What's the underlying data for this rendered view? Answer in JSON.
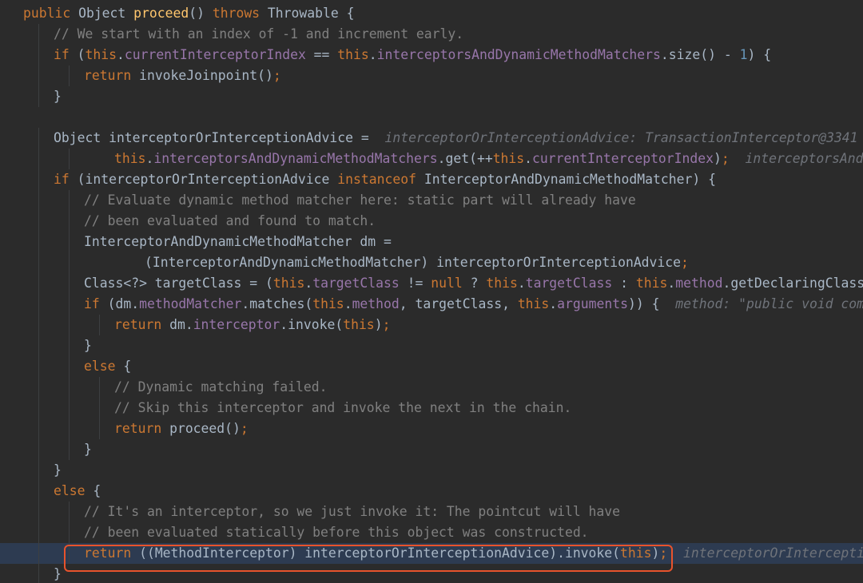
{
  "code_lines": [
    [
      [
        "kw",
        "public "
      ],
      [
        "plain",
        "Object "
      ],
      [
        "fn",
        "proceed"
      ],
      [
        "plain",
        "() "
      ],
      [
        "kw",
        "throws "
      ],
      [
        "plain",
        "Throwable {"
      ]
    ],
    [
      [
        "cmt",
        "// We start with an index of -1 and increment early."
      ]
    ],
    [
      [
        "kw",
        "if "
      ],
      [
        "plain",
        "("
      ],
      [
        "kw",
        "this"
      ],
      [
        "plain",
        "."
      ],
      [
        "fld",
        "currentInterceptorIndex"
      ],
      [
        "plain",
        " == "
      ],
      [
        "kw",
        "this"
      ],
      [
        "plain",
        "."
      ],
      [
        "fld",
        "interceptorsAndDynamicMethodMatchers"
      ],
      [
        "plain",
        ".size() - "
      ],
      [
        "num",
        "1"
      ],
      [
        "plain",
        ") {"
      ]
    ],
    [
      [
        "kw",
        "return "
      ],
      [
        "plain",
        "invokeJoinpoint()"
      ],
      [
        "kw",
        ";"
      ]
    ],
    [
      [
        "plain",
        "}"
      ]
    ],
    [],
    [
      [
        "plain",
        "Object interceptorOrInterceptionAdvice = "
      ],
      [
        "hint",
        " interceptorOrInterceptionAdvice: TransactionInterceptor@3341"
      ]
    ],
    [
      [
        "kw",
        "this"
      ],
      [
        "plain",
        "."
      ],
      [
        "fld",
        "interceptorsAndDynamicMethodMatchers"
      ],
      [
        "plain",
        ".get(++"
      ],
      [
        "kw",
        "this"
      ],
      [
        "plain",
        "."
      ],
      [
        "fld",
        "currentInterceptorIndex"
      ],
      [
        "plain",
        ")"
      ],
      [
        "kw",
        ";"
      ],
      [
        "hint",
        "  interceptorsAndDyna"
      ]
    ],
    [
      [
        "kw",
        "if "
      ],
      [
        "plain",
        "(interceptorOrInterceptionAdvice "
      ],
      [
        "kw",
        "instanceof "
      ],
      [
        "plain",
        "InterceptorAndDynamicMethodMatcher) {"
      ]
    ],
    [
      [
        "cmt",
        "// Evaluate dynamic method matcher here: static part will already have"
      ]
    ],
    [
      [
        "cmt",
        "// been evaluated and found to match."
      ]
    ],
    [
      [
        "plain",
        "InterceptorAndDynamicMethodMatcher dm ="
      ]
    ],
    [
      [
        "plain",
        "(InterceptorAndDynamicMethodMatcher) interceptorOrInterceptionAdvice"
      ],
      [
        "kw",
        ";"
      ]
    ],
    [
      [
        "plain",
        "Class<?> targetClass = ("
      ],
      [
        "kw",
        "this"
      ],
      [
        "plain",
        "."
      ],
      [
        "fld",
        "targetClass"
      ],
      [
        "plain",
        " != "
      ],
      [
        "kw",
        "null "
      ],
      [
        "plain",
        "? "
      ],
      [
        "kw",
        "this"
      ],
      [
        "plain",
        "."
      ],
      [
        "fld",
        "targetClass"
      ],
      [
        "plain",
        " : "
      ],
      [
        "kw",
        "this"
      ],
      [
        "plain",
        "."
      ],
      [
        "fld",
        "method"
      ],
      [
        "plain",
        ".getDeclaringClass())"
      ]
    ],
    [
      [
        "kw",
        "if "
      ],
      [
        "plain",
        "(dm."
      ],
      [
        "fld",
        "methodMatcher"
      ],
      [
        "plain",
        ".matches("
      ],
      [
        "kw",
        "this"
      ],
      [
        "plain",
        "."
      ],
      [
        "fld",
        "method"
      ],
      [
        "plain",
        ", targetClass, "
      ],
      [
        "kw",
        "this"
      ],
      [
        "plain",
        "."
      ],
      [
        "fld",
        "arguments"
      ],
      [
        "plain",
        ")) {"
      ],
      [
        "hint",
        "  method: \"public void com.myb"
      ]
    ],
    [
      [
        "kw",
        "return "
      ],
      [
        "plain",
        "dm."
      ],
      [
        "fld",
        "interceptor"
      ],
      [
        "plain",
        ".invoke("
      ],
      [
        "kw",
        "this"
      ],
      [
        "plain",
        ")"
      ],
      [
        "kw",
        ";"
      ]
    ],
    [
      [
        "plain",
        "}"
      ]
    ],
    [
      [
        "kw",
        "else "
      ],
      [
        "plain",
        "{"
      ]
    ],
    [
      [
        "cmt",
        "// Dynamic matching failed."
      ]
    ],
    [
      [
        "cmt",
        "// Skip this interceptor and invoke the next in the chain."
      ]
    ],
    [
      [
        "kw",
        "return "
      ],
      [
        "plain",
        "proceed()"
      ],
      [
        "kw",
        ";"
      ]
    ],
    [
      [
        "plain",
        "}"
      ]
    ],
    [
      [
        "plain",
        "}"
      ]
    ],
    [
      [
        "kw",
        "else "
      ],
      [
        "plain",
        "{"
      ]
    ],
    [
      [
        "cmt",
        "// It's an interceptor, so we just invoke it: The pointcut will have"
      ]
    ],
    [
      [
        "cmt",
        "// been evaluated statically before this object was constructed."
      ]
    ],
    [
      [
        "kw",
        "return "
      ],
      [
        "plain",
        "((MethodInterceptor) interceptorOrInterceptionAdvice).invoke("
      ],
      [
        "kw",
        "this"
      ],
      [
        "plain",
        ")"
      ],
      [
        "kw",
        ";"
      ],
      [
        "hint",
        "  interceptorOrInterceptionAd"
      ]
    ],
    [
      [
        "plain",
        "}"
      ]
    ]
  ],
  "current_line": 26,
  "boxed_line": 26
}
